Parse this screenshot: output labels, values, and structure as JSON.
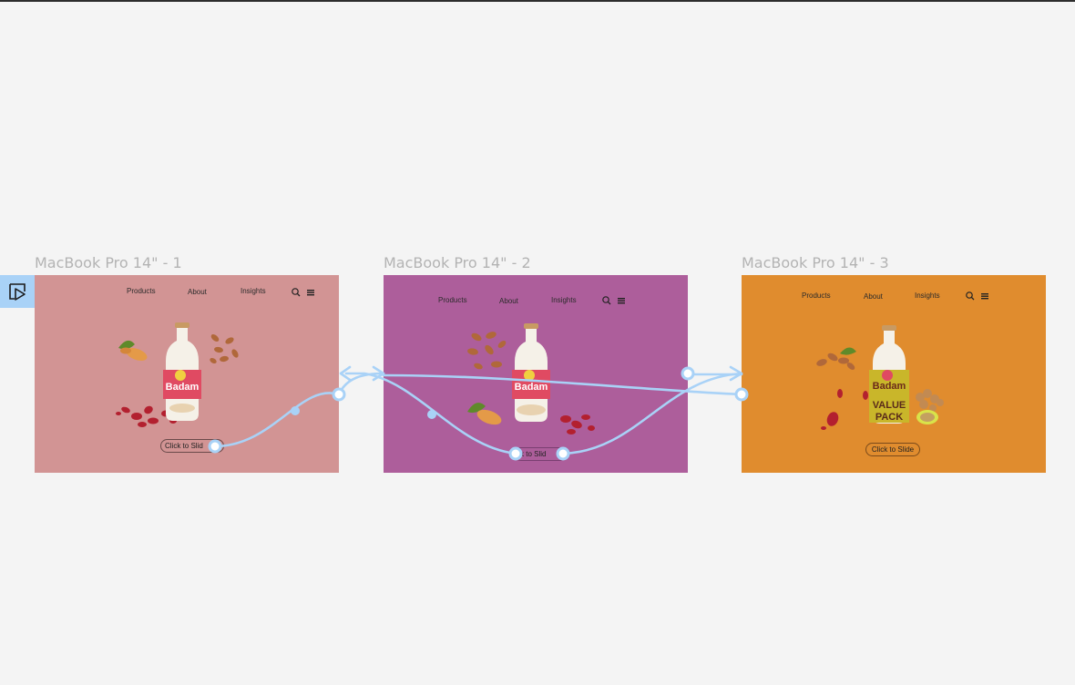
{
  "canvas": {
    "background": "#f4f4f4",
    "flow_start_icon": "prototype-flow-start-icon"
  },
  "frames": [
    {
      "label": "MacBook Pro 14\" - 1",
      "color": "#d29494",
      "nav": [
        "Products",
        "About",
        "Insights"
      ],
      "cta": "Click to Slide",
      "cta_visible": "Click to Slid",
      "bottle_label": "Badam",
      "bottle_color": "#e04a62"
    },
    {
      "label": "MacBook Pro 14\" - 2",
      "color": "#ad5e9b",
      "nav": [
        "Products",
        "About",
        "Insights"
      ],
      "cta": "Click to Slide",
      "cta_visible": "ck to Slid",
      "bottle_label": "Badam",
      "bottle_color": "#e04a62"
    },
    {
      "label": "MacBook Pro 14\" - 3",
      "color": "#e08c2e",
      "nav": [
        "Products",
        "About",
        "Insights"
      ],
      "cta": "Click to Slide",
      "cta_visible": "Click to Slide",
      "bottle_label": "Badam",
      "bottle_sub": "VALUE PACK",
      "bottle_color": "#c9b62a"
    }
  ],
  "wire_color": "#a9d2f7"
}
